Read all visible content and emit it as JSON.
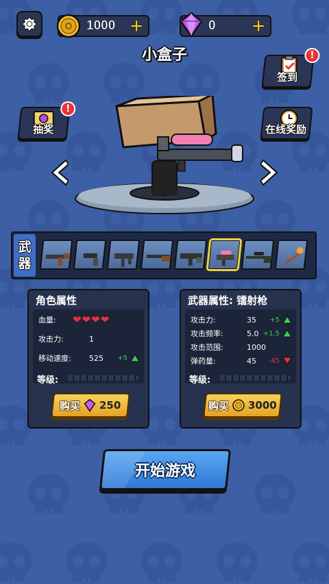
{
  "header": {
    "coins": "1000",
    "gems": "0",
    "coin_plus": "+",
    "gem_plus": "+",
    "character_name": "小盒子"
  },
  "side_buttons": {
    "signin_label": "签到",
    "lottery_label": "抽奖",
    "online_reward_label": "在线奖励",
    "badge_text": "!"
  },
  "weapon_bar": {
    "tag_line1": "武",
    "tag_line2": "器",
    "slots": [
      "ak-rifle-icon",
      "pistol-icon",
      "smg-icon",
      "shotgun-icon",
      "assault-rifle-icon",
      "laser-gun-icon",
      "sniper-rifle-icon",
      "staff-icon"
    ],
    "selected_index": 5
  },
  "character_panel": {
    "title": "角色属性",
    "hp_label": "血量:",
    "hp_hearts": "❤❤❤❤",
    "attack_label": "攻击力:",
    "attack_value": "1",
    "speed_label": "移动速度:",
    "speed_value": "525",
    "speed_delta": "+5",
    "level_label": "等级:",
    "buy_label": "购买",
    "buy_price": "250"
  },
  "weapon_panel": {
    "title": "武器属性: 镭射枪",
    "attack_label": "攻击力:",
    "attack_value": "35",
    "attack_delta": "+5",
    "rate_label": "攻击频率:",
    "rate_value": "5.0",
    "rate_delta": "+1.5",
    "range_label": "攻击范围:",
    "range_value": "1000",
    "ammo_label": "弹药量:",
    "ammo_value": "45",
    "ammo_delta": "-45",
    "level_label": "等级:",
    "buy_label": "购买",
    "buy_price": "3000"
  },
  "start_button": {
    "label": "开始游戏"
  },
  "colors": {
    "background": "#3d5fa6",
    "panel": "#27324f",
    "gold": "#f7d13c",
    "up": "#3ecc57",
    "down": "#e8333b",
    "start": "#3b88e0"
  }
}
